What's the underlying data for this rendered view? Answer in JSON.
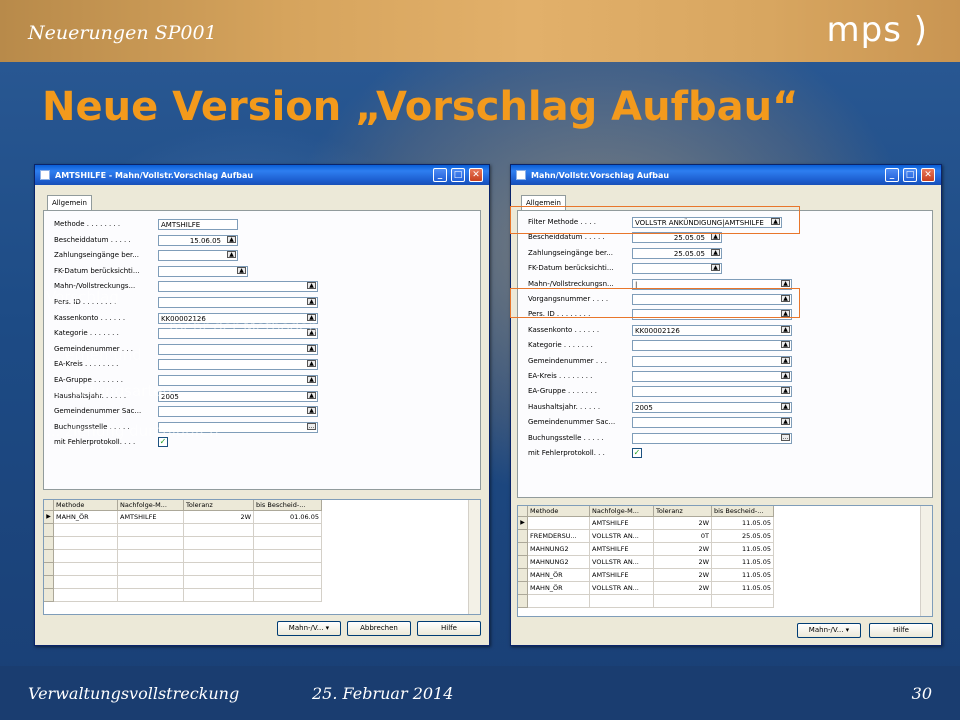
{
  "header": {
    "section": "Neuerungen SP001",
    "logo": "mps )"
  },
  "title": "Neue Version „Vorschlag Aufbau“",
  "footer": {
    "left": "Verwaltungsvollstreckung",
    "date": "25. Februar 2014",
    "page": "30"
  },
  "colors": {
    "title": "#f39a1c",
    "header_bar": "#d6a45d",
    "highlight": "#e8762b"
  },
  "left_window": {
    "title": "AMTSHILFE - Mahn/Vollstr.Vorschlag Aufbau",
    "tab": "Allgemein",
    "fields": [
      {
        "label": "Methode . . . . . . . .",
        "value": "AMTSHILFE"
      },
      {
        "label": "Bescheiddatum . . . . .",
        "value": "15.06.05"
      },
      {
        "label": "Zahlungseingänge ber...",
        "value": ""
      },
      {
        "label": "FK-Datum berücksichti...",
        "value": ""
      },
      {
        "label": "Mahn-/Vollstreckungs...",
        "value": ""
      },
      {
        "label": "Pers. ID . . . . . . . .",
        "value": ""
      },
      {
        "label": "Kassenkonto . . . . . .",
        "value": "KK00002126"
      },
      {
        "label": "Kategorie . . . . . . .",
        "value": ""
      },
      {
        "label": "Gemeindenummer . . .",
        "value": ""
      },
      {
        "label": "EA-Kreis . . . . . . . .",
        "value": ""
      },
      {
        "label": "EA-Gruppe . . . . . . .",
        "value": ""
      },
      {
        "label": "Haushaltsjahr. . . . . .",
        "value": "2005"
      },
      {
        "label": "Gemeindenummer Sac...",
        "value": ""
      },
      {
        "label": "Buchungsstelle . . . . .",
        "value": ""
      },
      {
        "label": "mit Fehlerprotokoll. . . .",
        "value": "✓"
      }
    ],
    "grid_headers": [
      "Methode",
      "Nachfolge-M...",
      "Toleranz",
      "bis Bescheid-..."
    ],
    "grid_rows": [
      [
        "MAHN_ÖR",
        "AMTSHILFE",
        "2W",
        "01.06.05"
      ]
    ],
    "buttons": {
      "menu": "Mahn-/V...",
      "cancel": "Abbrechen",
      "help": "Hilfe"
    },
    "overlay_text": [
      "Vorschlag",
      "... mehr der Methoden",
      "... ernen und",
      "... Haltungsarten",
      "... ziehung durchlaufen"
    ]
  },
  "right_window": {
    "title": "Mahn/Vollstr.Vorschlag Aufbau",
    "tab": "Allgemein",
    "fields": [
      {
        "label": "Filter Methode . . . .",
        "value": "VOLLSTR ANKÜNDIGUNG|AMTSHILFE"
      },
      {
        "label": "Bescheiddatum . . . . .",
        "value": "25.05.05"
      },
      {
        "label": "Zahlungseingänge ber...",
        "value": "25.05.05"
      },
      {
        "label": "FK-Datum berücksichti...",
        "value": ""
      },
      {
        "label": "Mahn-/Vollstreckungsn...",
        "value": "|"
      },
      {
        "label": "Vorgangsnummer . . . .",
        "value": ""
      },
      {
        "label": "Pers. ID . . . . . . . .",
        "value": ""
      },
      {
        "label": "Kassenkonto . . . . . .",
        "value": "KK00002126"
      },
      {
        "label": "Kategorie . . . . . . .",
        "value": ""
      },
      {
        "label": "Gemeindenummer . . .",
        "value": ""
      },
      {
        "label": "EA-Kreis . . . . . . . .",
        "value": ""
      },
      {
        "label": "EA-Gruppe . . . . . . .",
        "value": ""
      },
      {
        "label": "Haushaltsjahr. . . . . .",
        "value": "2005"
      },
      {
        "label": "Gemeindenummer Sac...",
        "value": ""
      },
      {
        "label": "Buchungsstelle . . . . .",
        "value": ""
      },
      {
        "label": "mit Fehlerprotokoll. . .",
        "value": "✓"
      }
    ],
    "grid_headers": [
      "Methode",
      "Nachfolge-M...",
      "Toleranz",
      "bis Bescheid-..."
    ],
    "grid_rows": [
      [
        "",
        "AMTSHILFE",
        "2W",
        "11.05.05"
      ],
      [
        "FREMDERSU...",
        "VOLLSTR AN...",
        "0T",
        "25.05.05"
      ],
      [
        "MAHNUNG2",
        "AMTSHILFE",
        "2W",
        "11.05.05"
      ],
      [
        "MAHNUNG2",
        "VOLLSTR AN...",
        "2W",
        "11.05.05"
      ],
      [
        "MAHN_ÖR",
        "AMTSHILFE",
        "2W",
        "11.05.05"
      ],
      [
        "MAHN_ÖR",
        "VOLLSTR AN...",
        "2W",
        "11.05.05"
      ]
    ],
    "buttons": {
      "menu": "Mahn-/V...",
      "help": "Hilfe"
    }
  }
}
